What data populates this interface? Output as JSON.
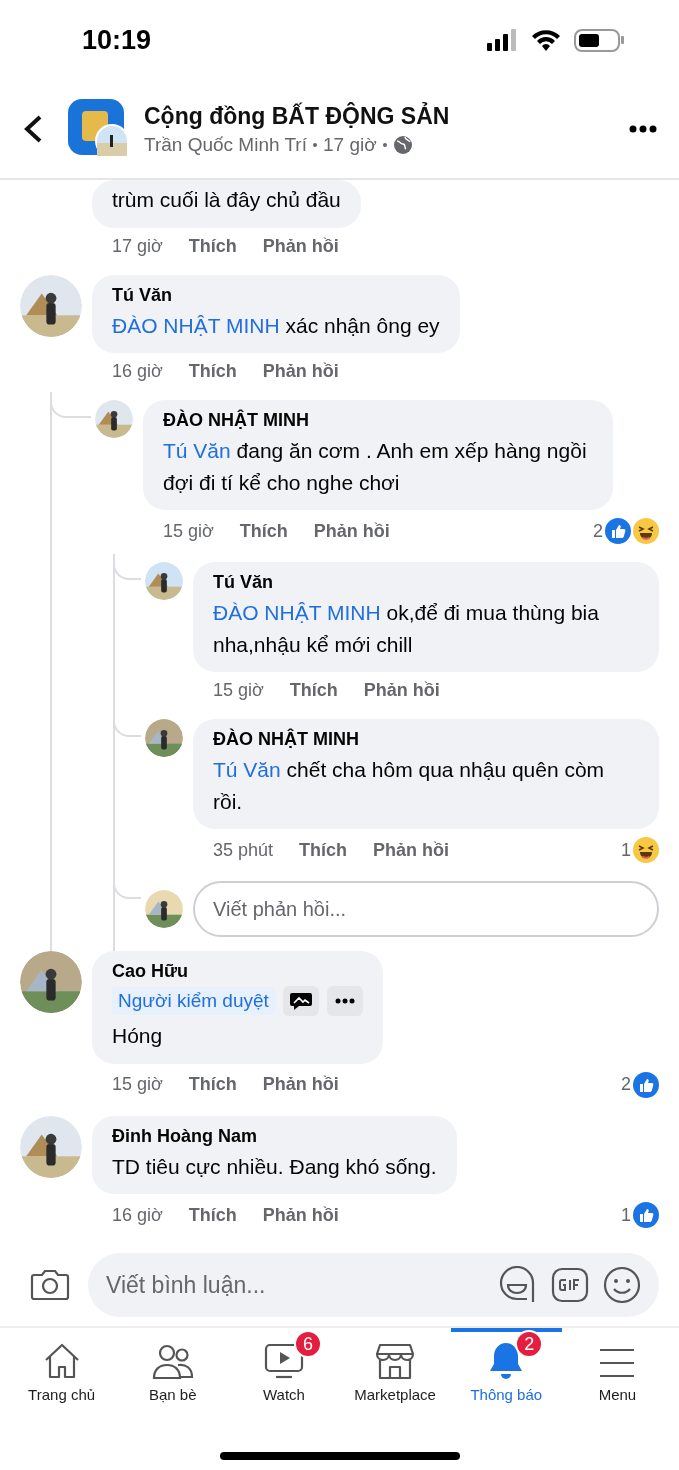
{
  "status_bar": {
    "time": "10:19"
  },
  "header": {
    "title": "Cộng đồng BẤT ĐỘNG SẢN",
    "author": "Trần Quốc Minh Trí",
    "time": "17 giờ"
  },
  "comments": [
    {
      "kind": "cut",
      "text": "trùm cuối là đây chủ đầu",
      "time": "17 giờ",
      "like": "Thích",
      "reply": "Phản hồi"
    },
    {
      "kind": "comment",
      "name": "Tú Văn",
      "mention": "ĐÀO NHẬT MINH",
      "text": "xác nhận ông ey",
      "time": "16 giờ",
      "like": "Thích",
      "reply": "Phản hồi",
      "children": [
        {
          "kind": "comment",
          "name": "ĐÀO NHẬT MINH",
          "mention": "Tú Văn",
          "text": "đang ăn cơm . Anh em xếp hàng ngồi đợi đi tí kể cho nghe chơi",
          "time": "15 giờ",
          "like": "Thích",
          "reply": "Phản hồi",
          "reactions": {
            "count": "2",
            "icons": [
              {
                "kind": "like"
              },
              {
                "kind": "haha"
              }
            ]
          },
          "children": [
            {
              "kind": "comment",
              "name": "Tú Văn",
              "mention": "ĐÀO NHẬT MINH",
              "text": "ok,để đi mua thùng bia nha,nhậu kể mới chill",
              "time": "15 giờ",
              "like": "Thích",
              "reply": "Phản hồi"
            },
            {
              "kind": "comment",
              "name": "ĐÀO NHẬT MINH",
              "mention": "Tú Văn",
              "text": "chết cha hôm qua nhậu quên còm rồi.",
              "time": "35 phút",
              "like": "Thích",
              "reply": "Phản hồi",
              "reactions": {
                "count": "1",
                "icons": [
                  {
                    "kind": "haha"
                  }
                ]
              }
            },
            {
              "kind": "reply_field",
              "placeholder": "Viết phản hồi..."
            }
          ]
        }
      ]
    },
    {
      "kind": "comment",
      "name": "Cao Hữu",
      "badge": "Người kiểm duyệt",
      "text": "Hóng",
      "time": "15 giờ",
      "like": "Thích",
      "reply": "Phản hồi",
      "reactions": {
        "count": "2",
        "icons": [
          {
            "kind": "like"
          }
        ]
      }
    },
    {
      "kind": "comment",
      "name": "Đinh Hoàng Nam",
      "text": "TD tiêu cực nhiều. Đang khó sống.",
      "time": "16 giờ",
      "like": "Thích",
      "reply": "Phản hồi",
      "reactions": {
        "count": "1",
        "icons": [
          {
            "kind": "like"
          }
        ]
      }
    }
  ],
  "composer": {
    "placeholder": "Viết bình luận..."
  },
  "tabs": [
    {
      "kind": "home",
      "label": "Trang chủ",
      "selected": false
    },
    {
      "kind": "friends",
      "label": "Bạn bè",
      "selected": false
    },
    {
      "kind": "watch",
      "label": "Watch",
      "badge": "6",
      "selected": false
    },
    {
      "kind": "market",
      "label": "Marketplace",
      "selected": false
    },
    {
      "kind": "bell",
      "label": "Thông báo",
      "badge": "2",
      "selected": true
    },
    {
      "kind": "menu",
      "label": "Menu",
      "selected": false
    }
  ]
}
